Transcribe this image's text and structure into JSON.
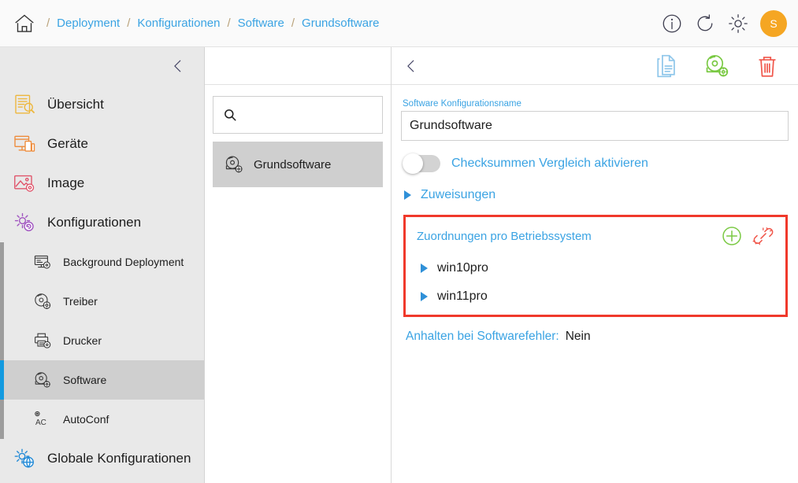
{
  "topbar": {
    "home_icon": "home-icon",
    "breadcrumbs": [
      {
        "label": "Deployment"
      },
      {
        "label": "Konfigurationen"
      },
      {
        "label": "Software"
      },
      {
        "label": "Grundsoftware"
      }
    ],
    "separator": "/",
    "actions": [
      {
        "name": "info-icon",
        "icon": "info-circle-icon"
      },
      {
        "name": "refresh-icon",
        "icon": "refresh-icon"
      },
      {
        "name": "settings-icon",
        "icon": "gear-icon"
      }
    ],
    "avatar_initial": "S",
    "avatar_color": "#f5a623"
  },
  "sidebar": {
    "collapse_icon": "chevron-left-icon",
    "items": [
      {
        "label": "Übersicht",
        "icon": "overview-icon",
        "color": "#edb73e"
      },
      {
        "label": "Geräte",
        "icon": "devices-icon",
        "color": "#ee8c3c"
      },
      {
        "label": "Image",
        "icon": "image-icon",
        "color": "#e0556b"
      },
      {
        "label": "Konfigurationen",
        "icon": "configurations-icon",
        "color": "#a053c0"
      }
    ],
    "subitems": [
      {
        "label": "Background Deployment",
        "icon": "background-deployment-icon",
        "active": false
      },
      {
        "label": "Treiber",
        "icon": "driver-disc-icon",
        "active": false
      },
      {
        "label": "Drucker",
        "icon": "printer-icon",
        "active": false
      },
      {
        "label": "Software",
        "icon": "software-disc-icon",
        "active": true
      },
      {
        "label": "AutoConf",
        "icon": "autoconf-icon",
        "active": false
      }
    ],
    "global": {
      "label": "Globale Konfigurationen",
      "icon": "global-configurations-icon",
      "color": "#1e88d6"
    },
    "active_color": "#139ae0"
  },
  "list_panel": {
    "search": {
      "placeholder": "",
      "value": "",
      "icon": "search-icon"
    },
    "items": [
      {
        "label": "Grundsoftware",
        "icon": "software-disc-icon",
        "active": true
      }
    ]
  },
  "detail": {
    "back_icon": "chevron-left-icon",
    "actions": [
      {
        "name": "duplicate-icon",
        "icon": "copy-documents-icon",
        "color": "#8ec6ea"
      },
      {
        "name": "software-package-icon",
        "icon": "disc-gear-icon",
        "color": "#7ac943"
      },
      {
        "name": "delete-icon",
        "icon": "trash-icon",
        "color": "#f0564a"
      }
    ],
    "name_field": {
      "label": "Software Konfigurationsname",
      "value": "Grundsoftware",
      "placeholder": ""
    },
    "checksum_toggle": {
      "label": "Checksummen Vergleich aktivieren",
      "state": "off"
    },
    "assignments_section": {
      "label": "Zuweisungen",
      "expanded": false
    },
    "os_section": {
      "title": "Zuordnungen pro Betriebssystem",
      "add_icon": "plus-circle-icon",
      "unlink_icon": "broken-link-icon",
      "highlight_color": "#f0392b",
      "rows": [
        {
          "label": "win10pro",
          "expanded": false
        },
        {
          "label": "win11pro",
          "expanded": false
        }
      ]
    },
    "halt_on_error": {
      "label": "Anhalten bei Softwarefehler:",
      "value": "Nein"
    }
  }
}
